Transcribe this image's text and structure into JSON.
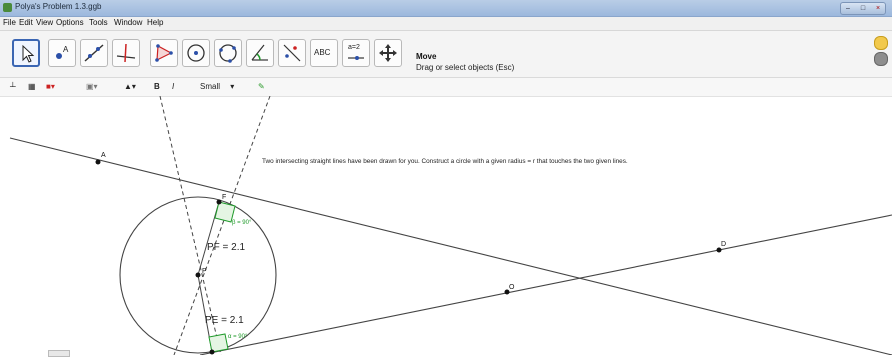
{
  "window": {
    "title": "Polya's Problem 1.3.ggb"
  },
  "menu": [
    "File",
    "Edit",
    "View",
    "Options",
    "Tools",
    "Window",
    "Help"
  ],
  "toolbar": {
    "tools": [
      "move-tool",
      "point-tool",
      "line-tool",
      "perpendicular-tool",
      "polygon-tool",
      "circle-tool",
      "conic-tool",
      "angle-tool",
      "reflect-tool",
      "text-tool",
      "slider-tool",
      "move-view-tool"
    ],
    "text_tool_label": "ABC",
    "slider_tool_label": "a=2",
    "active_tool_name": "Move",
    "active_tool_desc": "Drag or select objects (Esc)"
  },
  "stylebar": {
    "bold_label": "B",
    "italic_label": "I",
    "font_size": "Small"
  },
  "canvas": {
    "instruction": "Two intersecting straight lines have been drawn for you. Construct a circle with a given radius = r that touches the two given lines.",
    "labels": {
      "point_a": "A",
      "point_d": "D",
      "point_o": "O",
      "point_p": "P",
      "point_f": "F",
      "pf_length": "PF = 2.1",
      "pe_length": "PE = 2.1",
      "angle_f": "β = 90°",
      "angle_e": "α = 90°"
    },
    "colors": {
      "angle": "#1f9a2a",
      "line": "#333333",
      "point": "#111111"
    }
  }
}
